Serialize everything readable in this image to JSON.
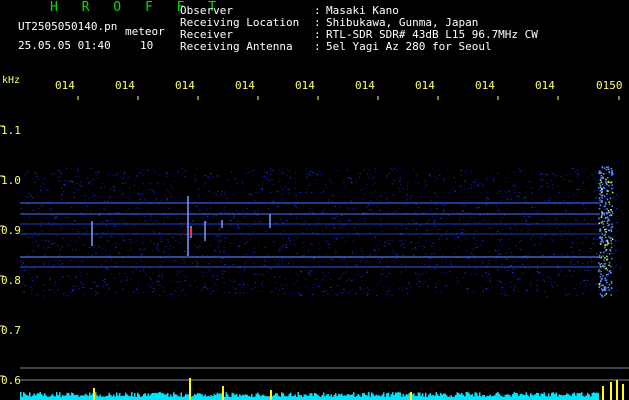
{
  "brand": "H R O F F T",
  "file_name": "UT2505050140.pn",
  "meteor_label": "meteor",
  "datetime": "25.05.05 01:40",
  "meteor_count": "10",
  "header": {
    "rows": [
      {
        "label": "Observer",
        "value": "Masaki Kano"
      },
      {
        "label": "Receiving Location",
        "value": "Shibukawa, Gunma, Japan"
      },
      {
        "label": "Receiver",
        "value": "RTL-SDR SDR# 43dB L15 96.7MHz CW"
      },
      {
        "label": "Receiving Antenna",
        "value": "5el Yagi Az 280 for Seoul"
      }
    ]
  },
  "y_unit": "kHz",
  "y_ticks": [
    "1.1",
    "1.0",
    "0.9",
    "0.8",
    "0.7",
    "0.6"
  ],
  "x_ticks": [
    "014",
    "014",
    "014",
    "014",
    "014",
    "014",
    "014",
    "014",
    "014",
    "0150"
  ],
  "colors": {
    "background": "#000000",
    "tick": "#ffff66",
    "brand": "#00e000",
    "noise": "#1a2cff",
    "histogram": "#00e5ff",
    "spike": "#ffff00"
  }
}
